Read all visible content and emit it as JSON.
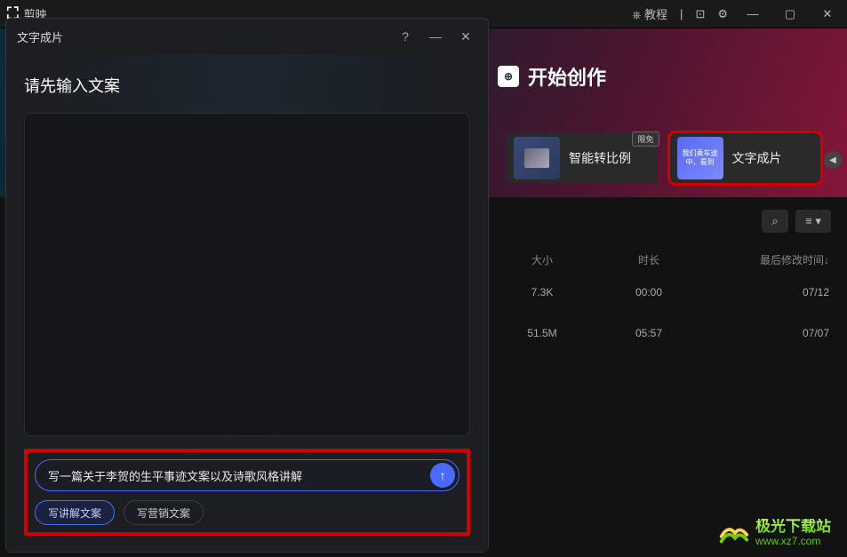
{
  "app": {
    "name": "剪映",
    "tutorial": "教程"
  },
  "main": {
    "start_creation": "开始创作",
    "features": {
      "smart_ratio": "智能转比例",
      "text_to_video": "文字成片",
      "text_to_video_thumb": "我们乘车途中，看到",
      "limited_badge": "限免"
    },
    "table": {
      "headers": {
        "size": "大小",
        "duration": "时长",
        "modified": "最后修改时间↓"
      },
      "rows": [
        {
          "size": "7.3K",
          "duration": "00:00",
          "modified": "07/12"
        },
        {
          "size": "51.5M",
          "duration": "05:57",
          "modified": "07/07"
        }
      ]
    }
  },
  "modal": {
    "title": "文字成片",
    "heading": "请先输入文案",
    "input_value": "写一篇关于李贺的生平事迹文案以及诗歌风格讲解",
    "presets": {
      "explain": "写讲解文案",
      "marketing": "写营销文案"
    }
  },
  "watermark": {
    "name": "极光下载站",
    "url": "www.xz7.com"
  }
}
